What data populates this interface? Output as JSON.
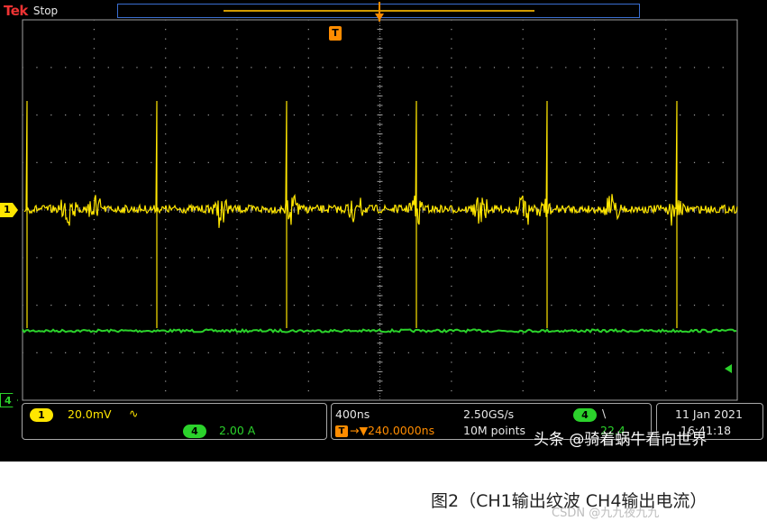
{
  "header": {
    "brand": "Tek",
    "status": "Stop",
    "trigger_badge": "T"
  },
  "channels": {
    "ch1": {
      "number": "1",
      "scale": "20.0mV",
      "coupling_symbol": "∿",
      "color": "#ffe600"
    },
    "ch4": {
      "number": "4",
      "scale": "2.00 A",
      "color": "#2bd22b"
    }
  },
  "timebase": {
    "horizontal_scale": "400ns",
    "sample_rate": "2.50GS/s",
    "record_length": "10M points",
    "trigger_position": "240.0000ns",
    "trigger_badge": "T",
    "trigger_arrow": "→▼",
    "trigger_channel": "4",
    "trigger_slope": "\\",
    "trigger_level": "22.4"
  },
  "datetime": {
    "date": "11 Jan 2021",
    "time": "16:41:18"
  },
  "watermark": "头条 @骑着蜗牛看向世界",
  "caption": "图2（CH1输出纹波 CH4输出电流）",
  "csdn_watermark": "CSDN @九九夜九九",
  "colors": {
    "grid": "#a0a0a0",
    "trigger": "#ff8c00",
    "background": "#000000"
  }
}
